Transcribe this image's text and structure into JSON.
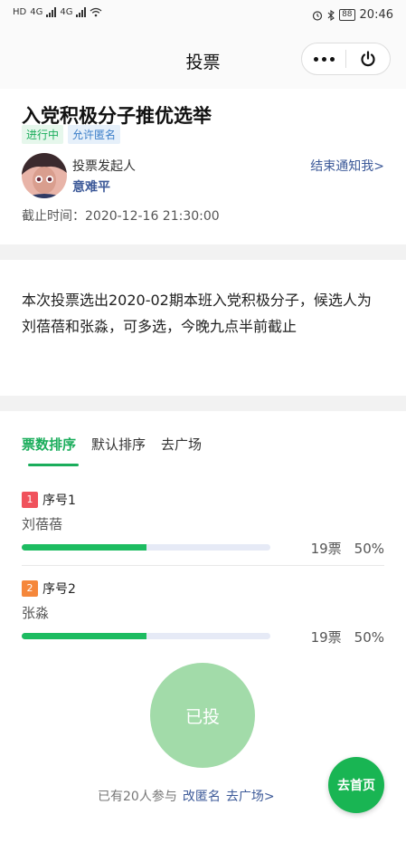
{
  "status_bar": {
    "time": "20:46",
    "battery": "88",
    "network_left": "HD",
    "signal_labels": [
      "4G",
      "4G"
    ]
  },
  "nav": {
    "title": "投票",
    "more_icon": "more-dots-icon",
    "close_icon": "power-icon"
  },
  "vote": {
    "title": "入党积极分子推优选举",
    "tags": [
      "进行中",
      "允许匿名"
    ],
    "initiator_label": "投票发起人",
    "initiator_name": "意难平",
    "notify_link": "结束通知我>",
    "deadline": "截止时间：2020-12-16 21:30:00"
  },
  "description": "本次投票选出2020-02期本班入党积极分子，候选人为刘蓓蓓和张淼，可多选，今晚九点半前截止",
  "tabs": [
    {
      "label": "票数排序",
      "active": true
    },
    {
      "label": "默认排序",
      "active": false
    },
    {
      "label": "去广场",
      "active": false
    }
  ],
  "options": [
    {
      "rank": "1",
      "seq": "序号1",
      "name": "刘蓓蓓",
      "votes": "19票",
      "percent": "50%",
      "fill": 0.5
    },
    {
      "rank": "2",
      "seq": "序号2",
      "name": "张淼",
      "votes": "19票",
      "percent": "50%",
      "fill": 0.5
    }
  ],
  "voted_button": "已投",
  "footer": {
    "participants": "已有20人参与",
    "anon_link": "改匿名",
    "square_link": "去广场>"
  },
  "home_button": "去首页",
  "colors": {
    "accent": "#1aad5b",
    "link": "#3d5a99",
    "voted": "#a2dba9",
    "rank1": "#f0525c",
    "rank2": "#f5873b"
  }
}
